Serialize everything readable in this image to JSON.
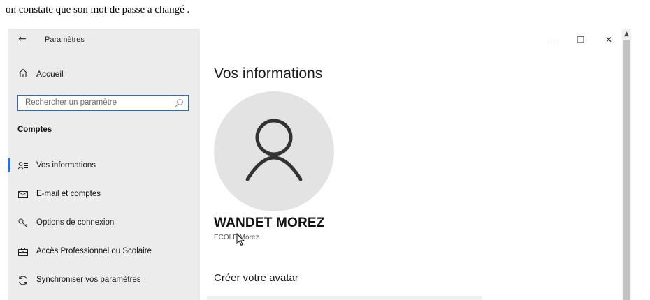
{
  "caption": {
    "text": "on constate que son mot de passe a changé ."
  },
  "window": {
    "app_title": "Paramètres",
    "controls": {
      "minimize": "—",
      "restore": "❐",
      "close": "✕"
    }
  },
  "sidebar": {
    "home_label": "Accueil",
    "search_placeholder": "Rechercher un paramètre",
    "section_title": "Comptes",
    "items": [
      {
        "label": "Vos informations",
        "icon": "person-list-icon",
        "selected": true
      },
      {
        "label": "E-mail et comptes",
        "icon": "mail-icon",
        "selected": false
      },
      {
        "label": "Options de connexion",
        "icon": "key-icon",
        "selected": false
      },
      {
        "label": "Accès Professionnel ou Scolaire",
        "icon": "briefcase-icon",
        "selected": false
      },
      {
        "label": "Synchroniser vos paramètres",
        "icon": "sync-icon",
        "selected": false
      }
    ]
  },
  "main": {
    "page_title": "Vos informations",
    "user_name": "WANDET MOREZ",
    "user_account": "ECOLE\\Morez",
    "avatar_heading": "Créer votre avatar"
  },
  "colors": {
    "accent": "#1a73e8",
    "sidebar_bg": "#ececec",
    "avatar_bg": "#e3e3e3"
  }
}
